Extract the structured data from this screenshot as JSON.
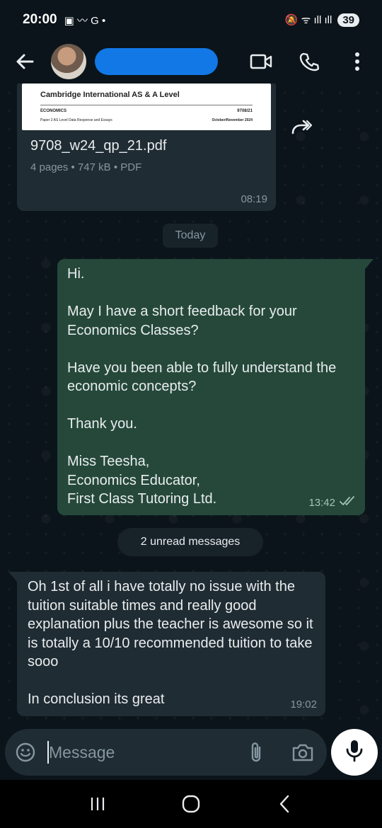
{
  "status_bar": {
    "time": "20:00",
    "left_glyphs": "▣ 〰 G •",
    "right_glyphs": "🔕 ᯤ ıll ıll",
    "battery": "39"
  },
  "header": {
    "contact_name": "-",
    "icons": [
      "back-arrow-icon",
      "video-call-icon",
      "voice-call-icon",
      "more-options-icon"
    ]
  },
  "messages": {
    "document": {
      "preview_title": "Cambridge International AS & A Level",
      "preview_subject": "ECONOMICS",
      "preview_code": "9708/21",
      "preview_paper": "Paper 2 AS Level Data Response and Essays",
      "preview_session": "October/November 2024",
      "filename": "9708_w24_qp_21.pdf",
      "meta": "4 pages • 747 kB • PDF",
      "time": "08:19"
    },
    "date_separator": "Today",
    "outgoing": {
      "text": "Hi.\n\nMay I have a short feedback for your Economics Classes?\n\nHave you been able to fully understand the economic concepts?\n\nThank you.\n\nMiss Teesha,\nEconomics Educator,\nFirst Class Tutoring Ltd.",
      "time": "13:42"
    },
    "unread_label": "2 unread messages",
    "incoming": {
      "text": "Oh 1st of all i have totally no issue with the tuition suitable times and really good explanation plus the teacher is awesome so it is totally a 10/10 recommended tuition to take sooo\n\nIn conclusion its great",
      "time": "19:02"
    }
  },
  "composer": {
    "placeholder": "Message"
  },
  "colors": {
    "background": "#0b141a",
    "incoming_bubble": "#202c33",
    "outgoing_bubble": "#25483a",
    "secondary_text": "#8696a0",
    "contact_name_highlight": "#1278e6"
  }
}
